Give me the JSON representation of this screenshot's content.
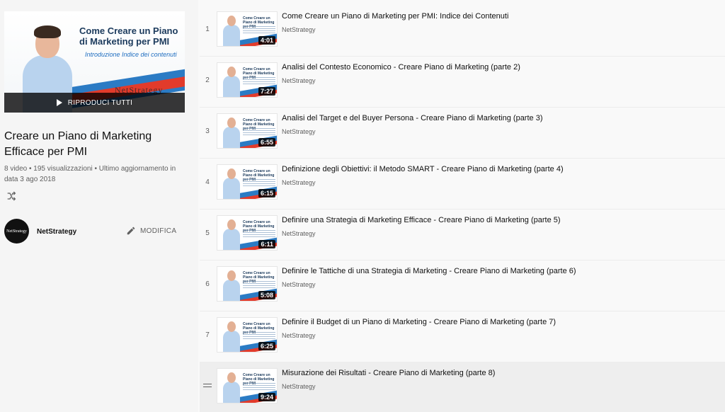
{
  "hero": {
    "title": "Come Creare un Piano di Marketing per PMI",
    "subtitle": "Introduzione Indice dei contenuti",
    "logo": "NetStrategy",
    "play_all_label": "RIPRODUCI TUTTI"
  },
  "playlist": {
    "title": "Creare un Piano di Marketing Efficace per PMI",
    "stats": "8 video • 195 visualizzazioni • Ultimo aggiornamento in data 3 ago 2018",
    "owner_name": "NetStrategy",
    "avatar_text": "NetStrategy",
    "edit_label": "MODIFICA"
  },
  "icons": {
    "shuffle": "shuffle-icon",
    "edit": "pencil-icon",
    "play": "play-icon",
    "drag": "drag-handle-icon"
  },
  "videos": [
    {
      "index": "1",
      "title": "Come Creare un Piano di Marketing per PMI: Indice dei Contenuti",
      "channel": "NetStrategy",
      "duration": "4:01",
      "thumb_text": "Come Creare un Piano di Marketing per PMI"
    },
    {
      "index": "2",
      "title": "Analisi del Contesto Economico - Creare Piano di Marketing (parte 2)",
      "channel": "NetStrategy",
      "duration": "7:27",
      "thumb_text": "Come Creare un Piano di Marketing per PMI"
    },
    {
      "index": "3",
      "title": "Analisi del Target e del Buyer Persona - Creare Piano di Marketing (parte 3)",
      "channel": "NetStrategy",
      "duration": "6:55",
      "thumb_text": "Come Creare un Piano di Marketing per PMI"
    },
    {
      "index": "4",
      "title": "Definizione degli Obiettivi: il Metodo SMART - Creare Piano di Marketing (parte 4)",
      "channel": "NetStrategy",
      "duration": "6:15",
      "thumb_text": "Come Creare un Piano di Marketing per PMI"
    },
    {
      "index": "5",
      "title": "Definire una Strategia di Marketing Efficace - Creare Piano di Marketing (parte 5)",
      "channel": "NetStrategy",
      "duration": "6:11",
      "thumb_text": "Come Creare un Piano di Marketing per PMI"
    },
    {
      "index": "6",
      "title": "Definire le Tattiche di una Strategia di Marketing - Creare Piano di Marketing (parte 6)",
      "channel": "NetStrategy",
      "duration": "5:08",
      "thumb_text": "Come Creare un Piano di Marketing per PMI"
    },
    {
      "index": "7",
      "title": "Definire il Budget di un Piano di Marketing - Creare Piano di Marketing (parte 7)",
      "channel": "NetStrategy",
      "duration": "6:25",
      "thumb_text": "Come Creare un Piano di Marketing per PMI"
    },
    {
      "index": "",
      "title": "Misurazione dei Risultati - Creare Piano di Marketing (parte 8)",
      "channel": "NetStrategy",
      "duration": "9:24",
      "thumb_text": "Come Creare un Piano di Marketing per PMI"
    }
  ]
}
